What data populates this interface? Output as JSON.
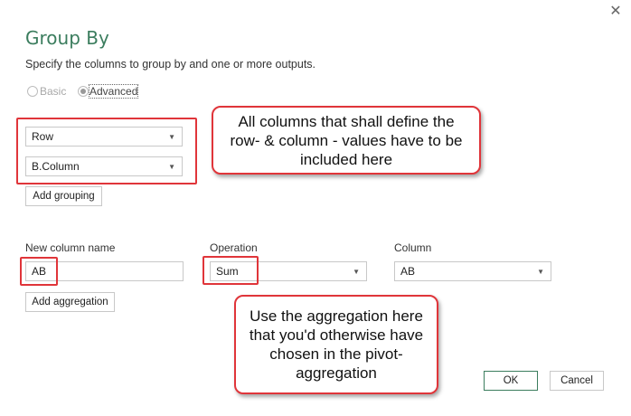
{
  "dialog": {
    "title": "Group By",
    "description": "Specify the columns to group by and one or more outputs.",
    "close_icon": "close-icon"
  },
  "mode": {
    "basic_label": "Basic",
    "advanced_label": "Advanced",
    "selected": "Advanced"
  },
  "grouping": {
    "columns": [
      "Row",
      "B.Column"
    ],
    "add_label": "Add grouping"
  },
  "aggregation": {
    "new_column_label": "New column name",
    "operation_label": "Operation",
    "column_label": "Column",
    "new_column_value": "AB",
    "operation_value": "Sum",
    "column_value": "AB",
    "add_label": "Add aggregation"
  },
  "callouts": {
    "grouping_note": "All columns that shall define the row- & column - values have to be included here",
    "aggregation_note": "Use the aggregation here that you'd otherwise have chosen in the pivot-aggregation"
  },
  "footer": {
    "ok_label": "OK",
    "cancel_label": "Cancel"
  },
  "colors": {
    "accent": "#3b7d5e",
    "highlight": "#e0353a"
  }
}
